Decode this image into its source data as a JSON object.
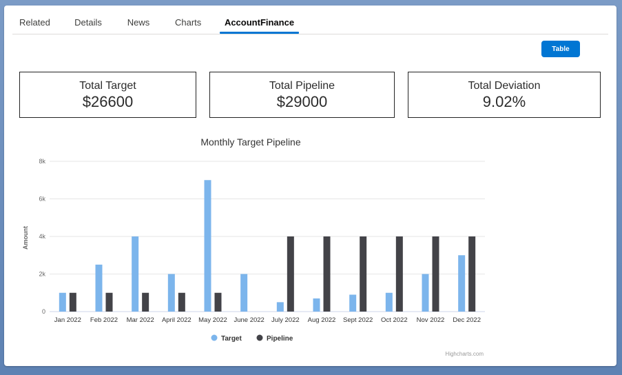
{
  "tabs": [
    {
      "label": "Related"
    },
    {
      "label": "Details"
    },
    {
      "label": "News"
    },
    {
      "label": "Charts"
    },
    {
      "label": "AccountFinance",
      "active": true
    }
  ],
  "table_button": {
    "label": "Table"
  },
  "kpis": [
    {
      "label": "Total Target",
      "value": "$26600"
    },
    {
      "label": "Total Pipeline",
      "value": "$29000"
    },
    {
      "label": "Total Deviation",
      "value": "9.02%"
    }
  ],
  "credits": "Highcharts.com",
  "colors": {
    "accent": "#0176d3",
    "target": "#7cb5ec",
    "pipeline": "#434348"
  },
  "chart_data": {
    "type": "bar",
    "title": "Monthly Target Pipeline",
    "xlabel": "",
    "ylabel": "Amount",
    "ylim": [
      0,
      8000
    ],
    "yticks": [
      "0",
      "2k",
      "4k",
      "6k",
      "8k"
    ],
    "categories": [
      "Jan 2022",
      "Feb 2022",
      "Mar 2022",
      "April 2022",
      "May 2022",
      "June 2022",
      "July 2022",
      "Aug 2022",
      "Sept 2022",
      "Oct 2022",
      "Nov 2022",
      "Dec 2022"
    ],
    "series": [
      {
        "name": "Target",
        "color": "#7cb5ec",
        "values": [
          1000,
          2500,
          4000,
          2000,
          7000,
          2000,
          500,
          700,
          900,
          1000,
          2000,
          3000
        ]
      },
      {
        "name": "Pipeline",
        "color": "#434348",
        "values": [
          1000,
          1000,
          1000,
          1000,
          1000,
          0,
          4000,
          4000,
          4000,
          4000,
          4000,
          4000
        ]
      }
    ],
    "grid": true,
    "legend": "bottom-center"
  }
}
